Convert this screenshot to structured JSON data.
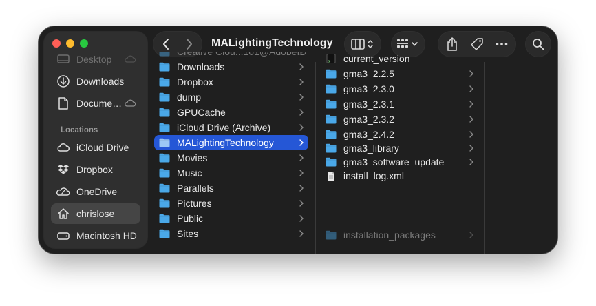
{
  "window": {
    "title": "MALightingTechnology"
  },
  "sidebar": {
    "favorites": [
      {
        "label": "Desktop",
        "icon": "desktop-icon",
        "faded": true,
        "cloud": true
      },
      {
        "label": "Downloads",
        "icon": "download-icon"
      },
      {
        "label": "Docume…",
        "icon": "document-icon",
        "cloud": true
      }
    ],
    "locations_header": "Locations",
    "locations": [
      {
        "label": "iCloud Drive",
        "icon": "cloud-icon"
      },
      {
        "label": "Dropbox",
        "icon": "dropbox-icon"
      },
      {
        "label": "OneDrive",
        "icon": "onedrive-icon"
      },
      {
        "label": "chrislose",
        "icon": "home-icon",
        "selected": true
      },
      {
        "label": "Macintosh HD",
        "icon": "drive-icon"
      }
    ]
  },
  "column1": [
    {
      "label": "Creative Clou...101@AdobeID",
      "faded": true
    },
    {
      "label": "Downloads"
    },
    {
      "label": "Dropbox"
    },
    {
      "label": "dump"
    },
    {
      "label": "GPUCache"
    },
    {
      "label": "iCloud Drive (Archive)"
    },
    {
      "label": "MALightingTechnology",
      "selected": true
    },
    {
      "label": "Movies"
    },
    {
      "label": "Music"
    },
    {
      "label": "Parallels"
    },
    {
      "label": "Pictures"
    },
    {
      "label": "Public"
    },
    {
      "label": "Sites"
    }
  ],
  "column2": [
    {
      "label": "current_version",
      "kind": "alias",
      "chevron": false
    },
    {
      "label": "gma3_2.2.5",
      "kind": "folder",
      "chevron": true
    },
    {
      "label": "gma3_2.3.0",
      "kind": "folder",
      "chevron": true
    },
    {
      "label": "gma3_2.3.1",
      "kind": "folder",
      "chevron": true
    },
    {
      "label": "gma3_2.3.2",
      "kind": "folder",
      "chevron": true
    },
    {
      "label": "gma3_2.4.2",
      "kind": "folder",
      "chevron": true
    },
    {
      "label": "gma3_library",
      "kind": "folder",
      "chevron": true
    },
    {
      "label": "gma3_software_update",
      "kind": "folder",
      "chevron": true
    },
    {
      "label": "install_log.xml",
      "kind": "file",
      "chevron": false
    },
    {
      "label": "installation_packages",
      "kind": "folder",
      "chevron": true,
      "faded": true
    }
  ],
  "colors": {
    "accent": "#2557d6",
    "folder": "#4aa8e8",
    "close": "#ff5f57",
    "minimize": "#febc2e",
    "maximize": "#28c840"
  }
}
